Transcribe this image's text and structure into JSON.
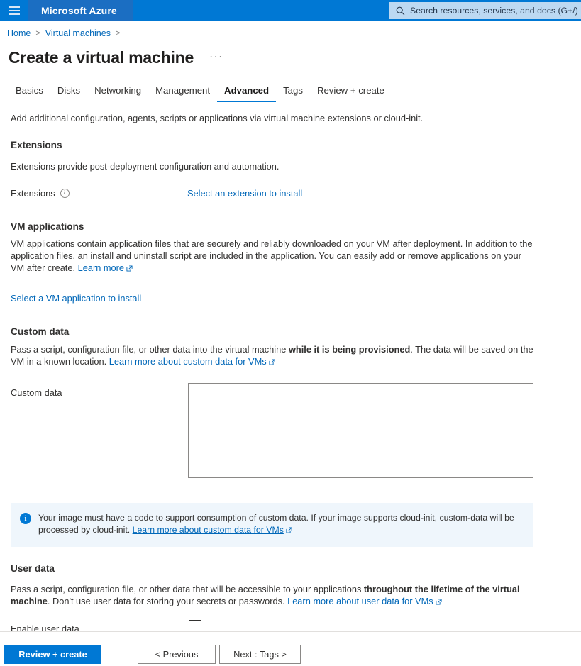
{
  "topbar": {
    "menu_icon": "hamburger-menu-icon",
    "brand": "Microsoft Azure",
    "search_icon": "search-icon",
    "search_placeholder": "Search resources, services, and docs (G+/)",
    "search_value": "",
    "brand_bg": "#1b6ec2",
    "bar_bg": "#0078d4"
  },
  "breadcrumb": {
    "home": "Home",
    "sep1": ">",
    "vms": "Virtual machines",
    "sep2": ">"
  },
  "page": {
    "title": "Create a virtual machine",
    "ellipsis": "···"
  },
  "tabs": [
    {
      "label": "Basics",
      "active": false
    },
    {
      "label": "Disks",
      "active": false
    },
    {
      "label": "Networking",
      "active": false
    },
    {
      "label": "Management",
      "active": false
    },
    {
      "label": "Advanced",
      "active": true
    },
    {
      "label": "Tags",
      "active": false
    },
    {
      "label": "Review + create",
      "active": false
    }
  ],
  "main": {
    "intro": "Add additional configuration, agents, scripts or applications via virtual machine extensions or cloud-init.",
    "extensions": {
      "heading": "Extensions",
      "description": "Extensions provide post-deployment configuration and automation.",
      "field_label": "Extensions",
      "info_icon": "info-circle-icon",
      "link": "Select an extension to install"
    },
    "vm_applications": {
      "heading": "VM applications",
      "description_part1": "VM applications contain application files that are securely and reliably downloaded on your VM after deployment. In addition to the application files, an install and uninstall script are included in the application. You can easily add or remove applications on your VM after create. ",
      "learn_more": "Learn more",
      "external_icon": "external-link-icon",
      "link": "Select a VM application to install"
    },
    "custom_data": {
      "heading": "Custom data",
      "desc_part1": "Pass a script, configuration file, or other data into the virtual machine ",
      "desc_bold": "while it is being provisioned",
      "desc_part2": ". The data will be saved on the VM in a known location. ",
      "learn_more": "Learn more about custom data for VMs",
      "field_label": "Custom data",
      "textarea_value": "",
      "textarea_placeholder": ""
    },
    "banner": {
      "icon": "info-filled-icon",
      "text_part1": "Your image must have a code to support consumption of custom data. If your image supports cloud-init, custom-data will be processed by cloud-init. ",
      "link": "Learn more about custom data for VMs",
      "bg": "#eff6fc"
    },
    "user_data": {
      "heading": "User data",
      "desc_part1": "Pass a script, configuration file, or other data that will be accessible to your applications ",
      "desc_bold": "throughout the lifetime of the virtual machine",
      "desc_part2": ". Don't use user data for storing your secrets or passwords. ",
      "learn_more": "Learn more about user data for VMs",
      "enable_label": "Enable user data",
      "enable_checked": false
    }
  },
  "footer": {
    "review_create": "Review + create",
    "previous": "< Previous",
    "next": "Next : Tags >",
    "primary_color": "#0078d4"
  }
}
